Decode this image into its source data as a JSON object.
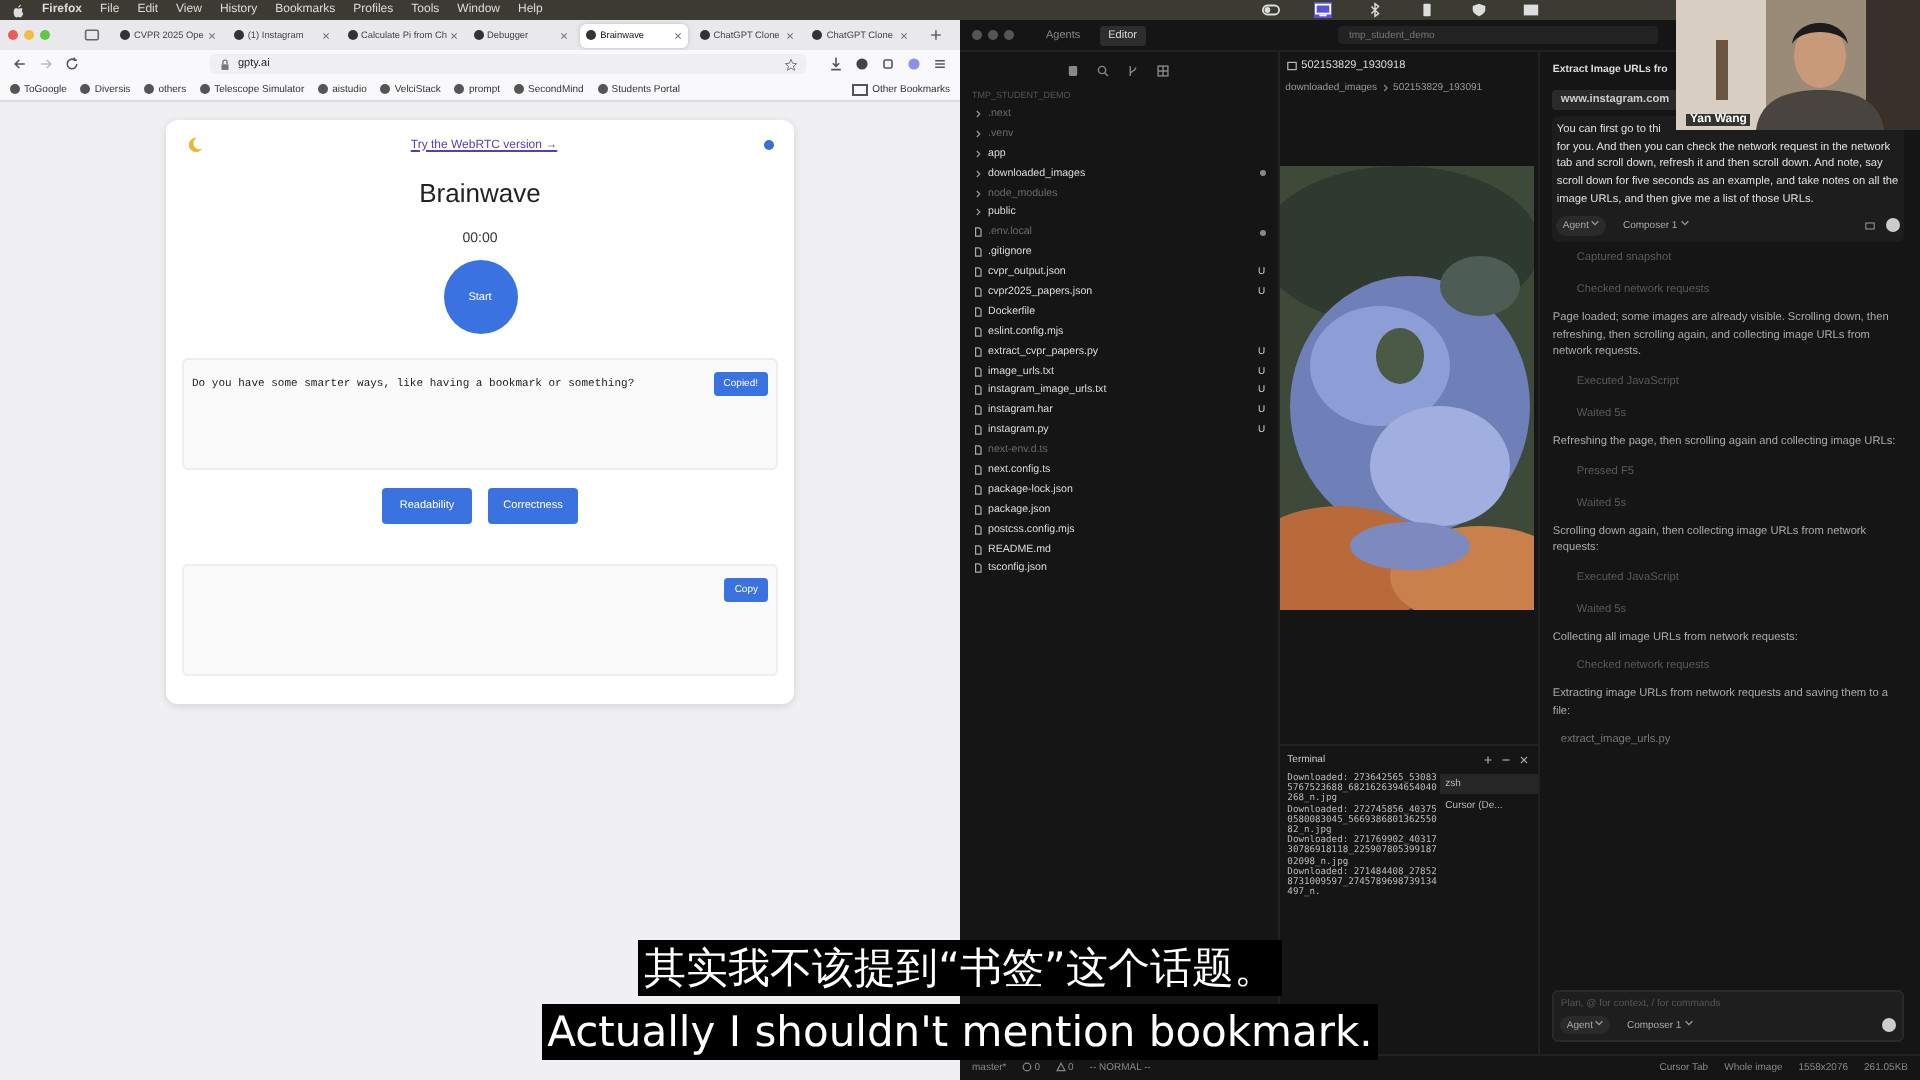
{
  "menubar": {
    "app": "Firefox",
    "items": [
      "File",
      "Edit",
      "View",
      "History",
      "Bookmarks",
      "Profiles",
      "Tools",
      "Window",
      "Help"
    ]
  },
  "browser": {
    "tabs": [
      {
        "title": "CVPR 2025 Ope",
        "selected": false
      },
      {
        "title": "(1) Instagram",
        "selected": false
      },
      {
        "title": "Calculate Pi from Ch",
        "selected": false
      },
      {
        "title": "Debugger",
        "selected": false
      },
      {
        "title": "Brainwave",
        "selected": true
      },
      {
        "title": "ChatGPT Clone",
        "selected": false
      },
      {
        "title": "ChatGPT Clone",
        "selected": false
      }
    ],
    "url": "gpty.ai",
    "bookmarks": [
      "ToGoogle",
      "Diversis",
      "others",
      "Telescope Simulator",
      "aistudio",
      "VelciStack",
      "prompt",
      "SecondMind",
      "Students Portal"
    ],
    "other_bookmarks": "Other Bookmarks"
  },
  "page": {
    "webrtc_link": "Try the WebRTC version →",
    "title": "Brainwave",
    "timer": "00:00",
    "start_button": "Start",
    "transcript": {
      "value": "Do you have some smarter ways, like having a bookmark or something?",
      "copy_button": "Copied!"
    },
    "actions": [
      "Readability",
      "Correctness"
    ],
    "output": {
      "copy_button": "Copy"
    }
  },
  "cursor": {
    "tabs": [
      {
        "label": "Agents",
        "selected": false
      },
      {
        "label": "Editor",
        "selected": true
      }
    ],
    "search": "tmp_student_demo",
    "explorer": {
      "title": "TMP_STUDENT_DEMO",
      "items": [
        {
          "name": ".next",
          "kind": "folder",
          "dimmed": true
        },
        {
          "name": ".venv",
          "kind": "folder",
          "dimmed": true
        },
        {
          "name": "app",
          "kind": "folder",
          "dimmed": false
        },
        {
          "name": "downloaded_images",
          "kind": "folder",
          "dimmed": false,
          "dot": true
        },
        {
          "name": "node_modules",
          "kind": "folder",
          "dimmed": true
        },
        {
          "name": "public",
          "kind": "folder",
          "dimmed": false
        },
        {
          "name": ".env.local",
          "kind": "file",
          "dimmed": true,
          "dot": true
        },
        {
          "name": ".gitignore",
          "kind": "file",
          "dimmed": false
        },
        {
          "name": "cvpr_output.json",
          "kind": "file",
          "dimmed": false,
          "badge": "U"
        },
        {
          "name": "cvpr2025_papers.json",
          "kind": "file",
          "dimmed": false,
          "badge": "U"
        },
        {
          "name": "Dockerfile",
          "kind": "file",
          "dimmed": false
        },
        {
          "name": "eslint.config.mjs",
          "kind": "file",
          "dimmed": false
        },
        {
          "name": "extract_cvpr_papers.py",
          "kind": "file",
          "dimmed": false,
          "badge": "U"
        },
        {
          "name": "image_urls.txt",
          "kind": "file",
          "dimmed": false,
          "badge": "U"
        },
        {
          "name": "instagram_image_urls.txt",
          "kind": "file",
          "dimmed": false,
          "badge": "U"
        },
        {
          "name": "instagram.har",
          "kind": "file",
          "dimmed": false,
          "badge": "U"
        },
        {
          "name": "instagram.py",
          "kind": "file",
          "dimmed": false,
          "badge": "U"
        },
        {
          "name": "next-env.d.ts",
          "kind": "file",
          "dimmed": true
        },
        {
          "name": "next.config.ts",
          "kind": "file",
          "dimmed": false
        },
        {
          "name": "package-lock.json",
          "kind": "file",
          "dimmed": false
        },
        {
          "name": "package.json",
          "kind": "file",
          "dimmed": false
        },
        {
          "name": "postcss.config.mjs",
          "kind": "file",
          "dimmed": false
        },
        {
          "name": "README.md",
          "kind": "file",
          "dimmed": false
        },
        {
          "name": "tsconfig.json",
          "kind": "file",
          "dimmed": false
        }
      ]
    },
    "editor": {
      "tab": "502153829_1930918",
      "breadcrumb": [
        "downloaded_images",
        "502153829_193091"
      ]
    },
    "terminal": {
      "title": "Terminal",
      "lines": [
        "Downloaded: 273642565_530835767523688_6821626394654040268_n.jpg",
        "Downloaded: 272745856_403750580083045_566938680136255082_n.jpg",
        "Downloaded: 271769902_4031730786918118_22590780539918702098_n.jpg",
        "Downloaded: 271484408_278528731009597_2745789698739134497_n."
      ],
      "sessions": [
        {
          "label": "zsh",
          "selected": true
        },
        {
          "label": "Cursor (De...",
          "selected": false
        }
      ]
    },
    "chat": {
      "title": "Extract Image URLs fro",
      "chip": "www.instagram.com",
      "first_line": "You can first go to thi",
      "message": "for you. And then you can check the network request in the network tab and scroll down, refresh it and then scroll down. And note, say scroll down for five seconds as an example, and take notes on all the image URLs, and then give me a list of those URLs.",
      "mode": "Agent",
      "model": "Composer 1",
      "entries": [
        {
          "kind": "step",
          "text": "Captured snapshot"
        },
        {
          "kind": "step",
          "text": "Checked network requests"
        },
        {
          "kind": "text",
          "text": "Page loaded; some images are already visible. Scrolling down, then refreshing, then scrolling again, and collecting image URLs from network requests."
        },
        {
          "kind": "step",
          "text": "Executed JavaScript"
        },
        {
          "kind": "step",
          "text": "Waited 5s"
        },
        {
          "kind": "text",
          "text": "Refreshing the page, then scrolling again and collecting image URLs:"
        },
        {
          "kind": "step",
          "text": "Pressed F5"
        },
        {
          "kind": "step",
          "text": "Waited 5s"
        },
        {
          "kind": "text",
          "text": "Scrolling down again, then collecting image URLs from network requests:"
        },
        {
          "kind": "step",
          "text": "Executed JavaScript"
        },
        {
          "kind": "step",
          "text": "Waited 5s"
        },
        {
          "kind": "text",
          "text": "Collecting all image URLs from network requests:"
        },
        {
          "kind": "step",
          "text": "Checked network requests"
        },
        {
          "kind": "text",
          "text": "Extracting image URLs from network requests and saving them to a file:"
        },
        {
          "kind": "file",
          "text": "extract_image_urls.py"
        }
      ],
      "input_placeholder": "Plan, @ for context, / for commands",
      "input_mode": "Agent",
      "input_model": "Composer 1"
    },
    "status_bar": {
      "branch": "master*",
      "errors": "0",
      "warnings": "0",
      "vim_mode": "-- NORMAL --",
      "right": [
        "Cursor Tab",
        "Whole image",
        "1558x2076",
        "261.05KB"
      ]
    }
  },
  "webcam": {
    "name": "Yan Wang"
  },
  "subtitles": [
    "其实我不该提到“书签”这个话题。",
    "Actually I shouldn't mention bookmark."
  ]
}
